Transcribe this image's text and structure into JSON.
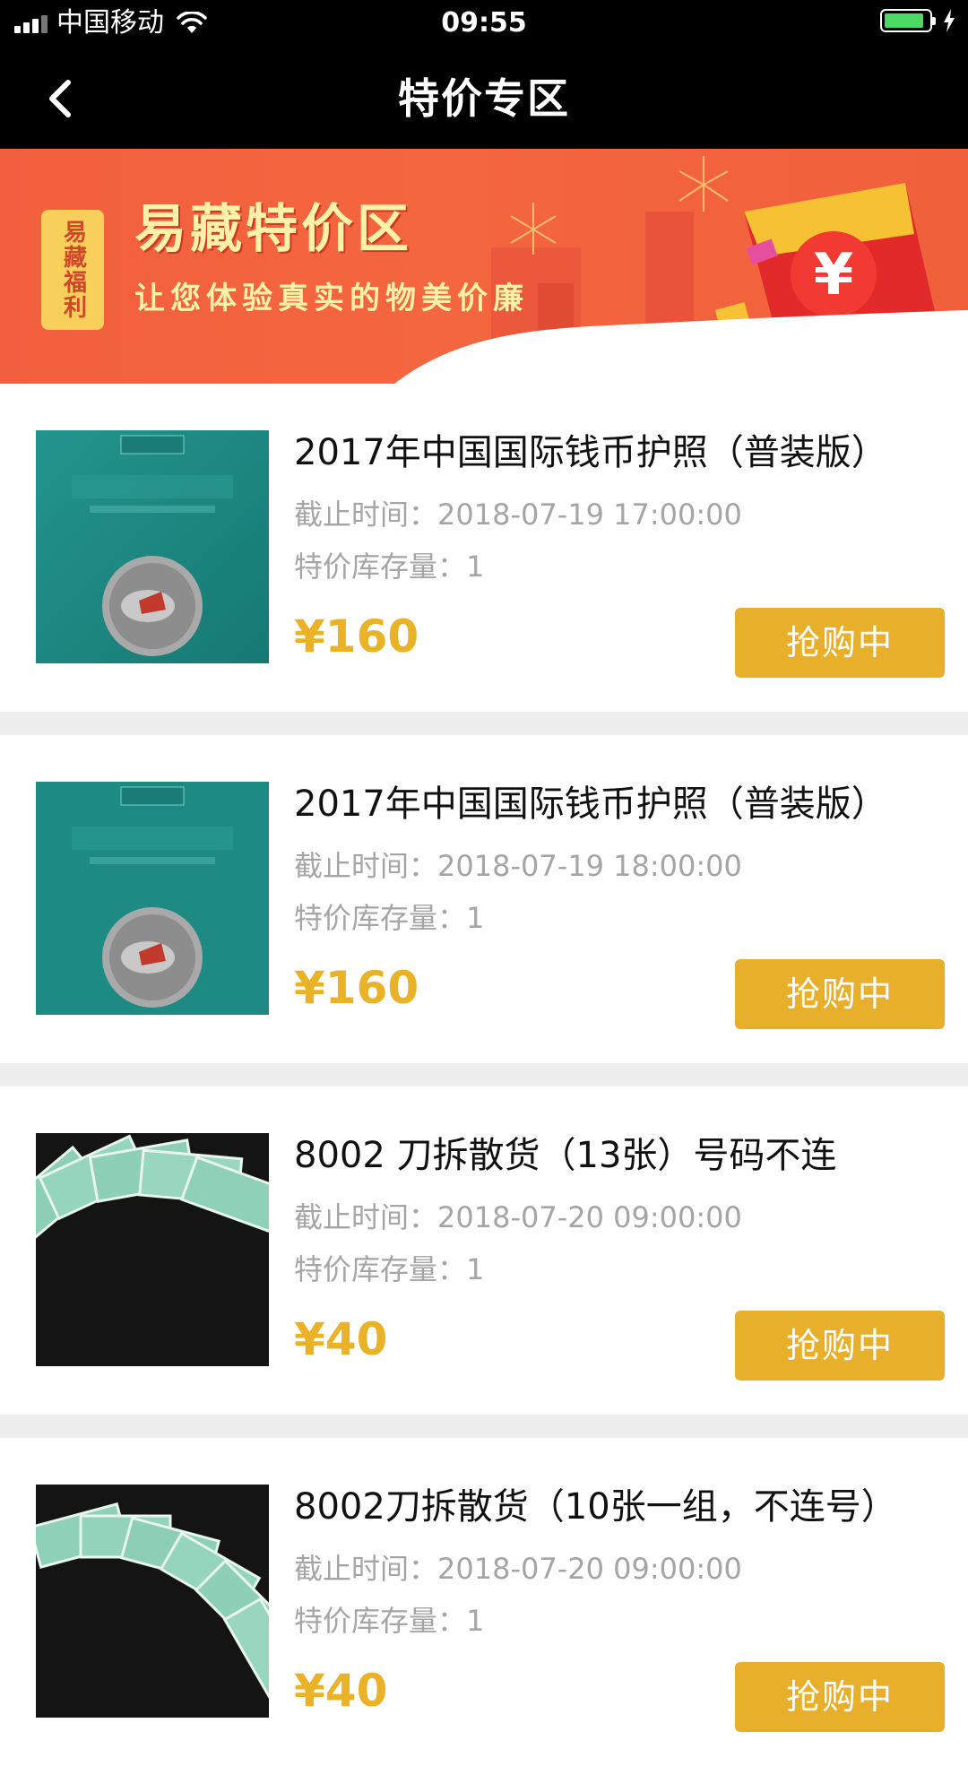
{
  "status_bar": {
    "carrier": "中国移动",
    "time": "09:55",
    "battery_level": 0.9
  },
  "nav": {
    "title": "特价专区",
    "back_icon": "chevron-left-icon"
  },
  "banner": {
    "tag": "易藏福利",
    "title": "易藏特价区",
    "subtitle": "让您体验真实的物美价廉",
    "colors": {
      "background": "#f25f3e",
      "text": "#fff2a8"
    }
  },
  "accent_colors": {
    "price": "#e9b227",
    "button": "#e8b02a"
  },
  "items": [
    {
      "name": "2017年中国国际钱币护照（普装版）",
      "deadline_label": "截止时间：",
      "deadline": "2018-07-19 17:00:00",
      "stock_label": "特价库存量：",
      "stock": "1",
      "price": "¥160",
      "button_label": "抢购中",
      "image": "coin-passport"
    },
    {
      "name": "2017年中国国际钱币护照（普装版）",
      "deadline_label": "截止时间：",
      "deadline": "2018-07-19 18:00:00",
      "stock_label": "特价库存量：",
      "stock": "1",
      "price": "¥160",
      "button_label": "抢购中",
      "image": "coin-passport"
    },
    {
      "name": "8002 刀拆散货（13张）号码不连",
      "deadline_label": "截止时间：",
      "deadline": "2018-07-20 09:00:00",
      "stock_label": "特价库存量：",
      "stock": "1",
      "price": "¥40",
      "button_label": "抢购中",
      "image": "banknote-fan"
    },
    {
      "name": "8002刀拆散货（10张一组，不连号）",
      "deadline_label": "截止时间：",
      "deadline": "2018-07-20 09:00:00",
      "stock_label": "特价库存量：",
      "stock": "1",
      "price": "¥40",
      "button_label": "抢购中",
      "image": "banknote-fan"
    }
  ]
}
